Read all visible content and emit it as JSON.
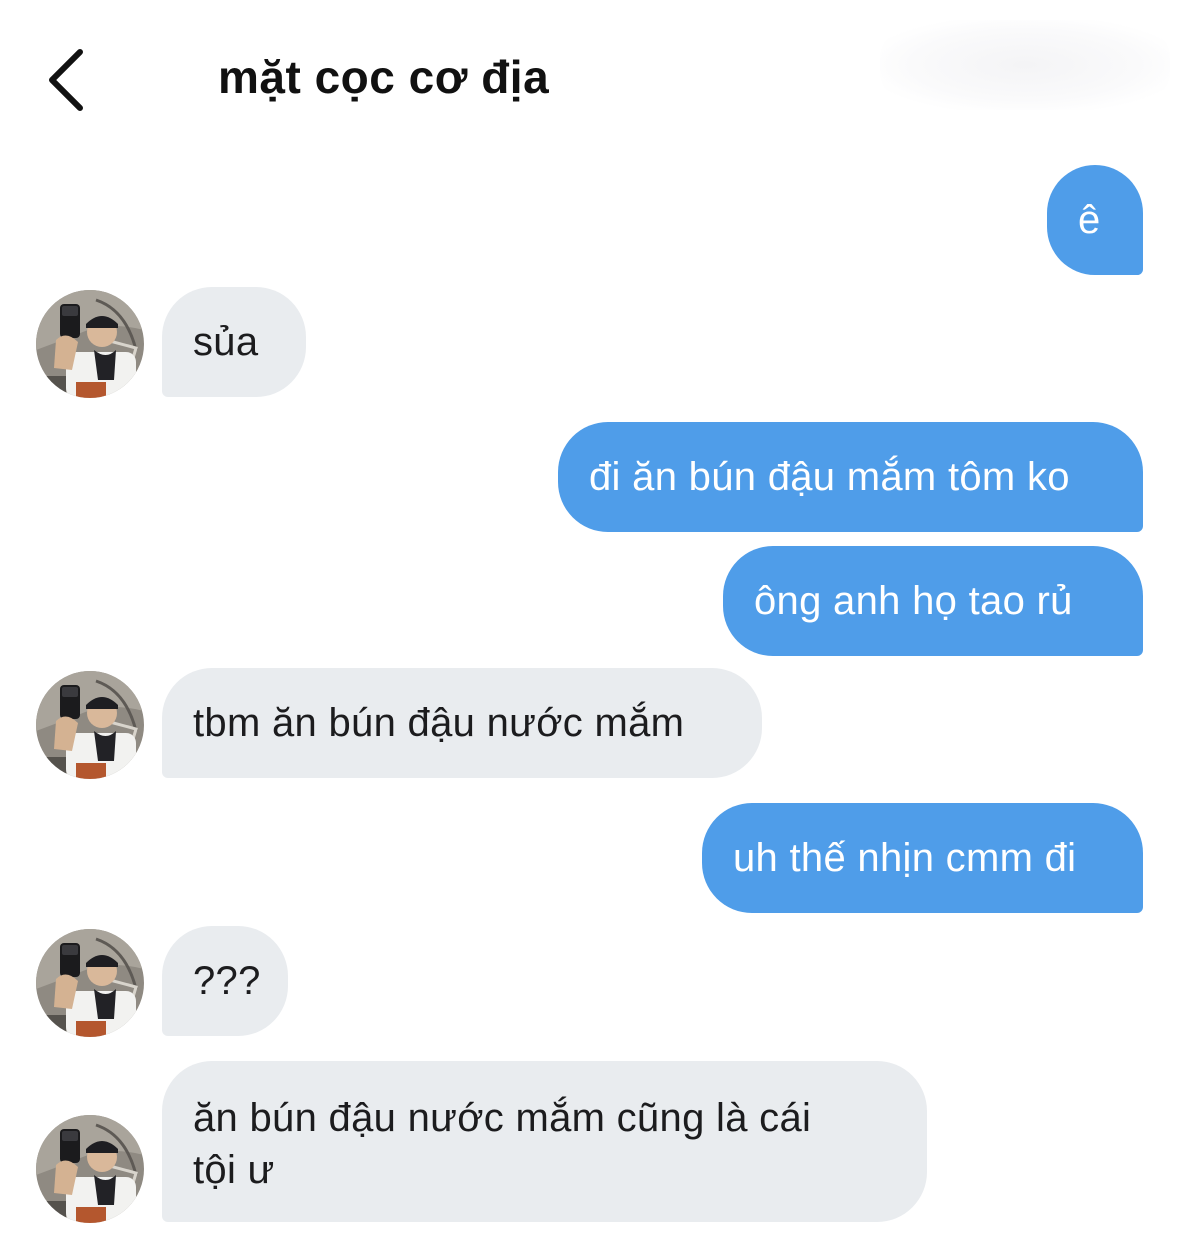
{
  "header": {
    "title": "mặt cọc cơ địa",
    "back_icon": "chevron-left-icon"
  },
  "messages": [
    {
      "direction": "outgoing",
      "text": "ê"
    },
    {
      "direction": "incoming",
      "text": "sủa"
    },
    {
      "direction": "outgoing",
      "text": "đi ăn bún đậu mắm tôm ko"
    },
    {
      "direction": "outgoing",
      "text": "ông anh họ tao rủ"
    },
    {
      "direction": "incoming",
      "text": "tbm ăn bún đậu nước mắm"
    },
    {
      "direction": "outgoing",
      "text": "uh thế nhịn cmm đi"
    },
    {
      "direction": "incoming",
      "text": "???"
    },
    {
      "direction": "incoming",
      "lines": [
        "ăn bún đậu nước mắm cũng là cái",
        "tội ư"
      ]
    }
  ],
  "colors": {
    "outgoing_bubble": "#4f9de9",
    "incoming_bubble": "#e9ecef",
    "outgoing_text": "#ffffff",
    "incoming_text": "#1c1c1e"
  }
}
